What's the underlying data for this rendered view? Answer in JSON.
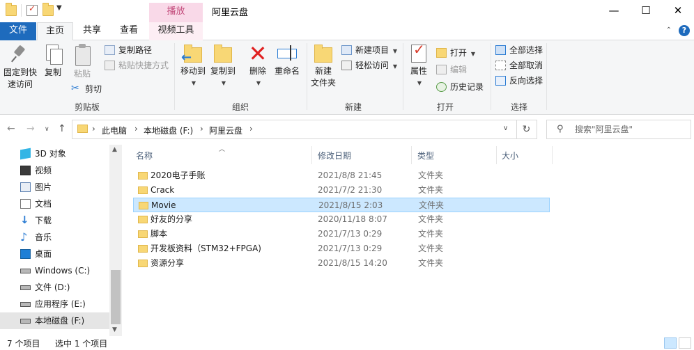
{
  "window": {
    "title": "阿里云盘",
    "context_tab": "播放",
    "minimize": "—",
    "maximize": "☐",
    "close": "✕"
  },
  "tabs": {
    "file": "文件",
    "home": "主页",
    "share": "共享",
    "view": "查看",
    "video_tools": "视频工具"
  },
  "ribbon": {
    "clipboard": {
      "label": "剪贴板",
      "pin_line1": "固定到快",
      "pin_line2": "速访问",
      "copy": "复制",
      "paste": "粘贴",
      "copy_path": "复制路径",
      "paste_shortcut": "粘贴快捷方式",
      "cut": "剪切"
    },
    "organize": {
      "label": "组织",
      "move_to": "移动到",
      "copy_to": "复制到",
      "delete": "删除",
      "rename": "重命名"
    },
    "new": {
      "label": "新建",
      "new_folder_line1": "新建",
      "new_folder_line2": "文件夹",
      "new_item": "新建项目",
      "easy_access": "轻松访问"
    },
    "open": {
      "label": "打开",
      "properties": "属性",
      "open": "打开",
      "edit": "编辑",
      "history": "历史记录"
    },
    "select": {
      "label": "选择",
      "select_all": "全部选择",
      "select_none": "全部取消",
      "invert": "反向选择"
    }
  },
  "address": {
    "crumbs": [
      "此电脑",
      "本地磁盘 (F:)",
      "阿里云盘"
    ],
    "search_placeholder": "搜索\"阿里云盘\""
  },
  "nav": {
    "items": [
      {
        "label": "3D 对象",
        "icon": "3d-objects-icon"
      },
      {
        "label": "视频",
        "icon": "videos-icon"
      },
      {
        "label": "图片",
        "icon": "pictures-icon"
      },
      {
        "label": "文档",
        "icon": "documents-icon"
      },
      {
        "label": "下载",
        "icon": "downloads-icon"
      },
      {
        "label": "音乐",
        "icon": "music-icon"
      },
      {
        "label": "桌面",
        "icon": "desktop-icon"
      },
      {
        "label": "Windows (C:)",
        "icon": "windows-drive-icon"
      },
      {
        "label": "文件 (D:)",
        "icon": "drive-icon"
      },
      {
        "label": "应用程序 (E:)",
        "icon": "drive-icon"
      },
      {
        "label": "本地磁盘 (F:)",
        "icon": "drive-icon",
        "selected": true
      }
    ]
  },
  "columns": {
    "name": "名称",
    "date": "修改日期",
    "type": "类型",
    "size": "大小"
  },
  "files": [
    {
      "name": "2020电子手账",
      "date": "2021/8/8 21:45",
      "type": "文件夹"
    },
    {
      "name": "Crack",
      "date": "2021/7/2 21:30",
      "type": "文件夹"
    },
    {
      "name": "Movie",
      "date": "2021/8/15 2:03",
      "type": "文件夹",
      "selected": true
    },
    {
      "name": "好友的分享",
      "date": "2020/11/18 8:07",
      "type": "文件夹"
    },
    {
      "name": "脚本",
      "date": "2021/7/13 0:29",
      "type": "文件夹"
    },
    {
      "name": "开发板资料（STM32+FPGA)",
      "date": "2021/7/13 0:29",
      "type": "文件夹"
    },
    {
      "name": "资源分享",
      "date": "2021/8/15 14:20",
      "type": "文件夹"
    }
  ],
  "status": {
    "item_count": "7 个项目",
    "selected": "选中 1 个项目"
  },
  "colors": {
    "file_tab": "#1e6bbd",
    "context_tab": "#f9d9e8",
    "selection": "#cce8ff",
    "folder": "#f8d775"
  }
}
